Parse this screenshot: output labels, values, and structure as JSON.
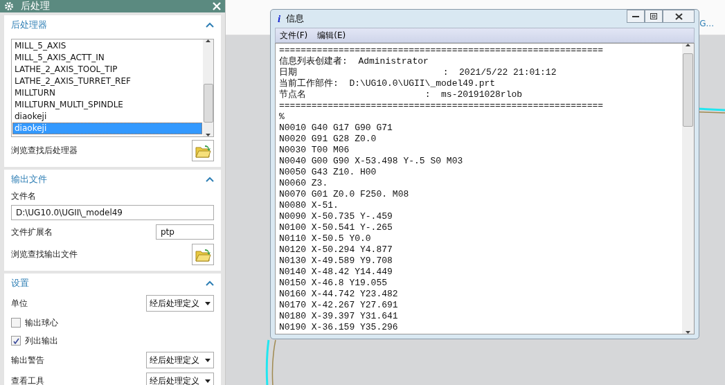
{
  "dialog": {
    "title": "后处理",
    "sections": [
      {
        "kind": "postprocessor",
        "title": "后处理器",
        "expanded": true,
        "list": [
          {
            "label": "MILL_5_AXIS",
            "selected": false
          },
          {
            "label": "MILL_5_AXIS_ACTT_IN",
            "selected": false
          },
          {
            "label": "LATHE_2_AXIS_TOOL_TIP",
            "selected": false
          },
          {
            "label": "LATHE_2_AXIS_TURRET_REF",
            "selected": false
          },
          {
            "label": "MILLTURN",
            "selected": false
          },
          {
            "label": "MILLTURN_MULTI_SPINDLE",
            "selected": false
          },
          {
            "label": "diaokeji",
            "selected": false
          },
          {
            "label": "diaokeji",
            "selected": true
          }
        ],
        "browse_label": "浏览查找后处理器"
      },
      {
        "kind": "output",
        "title": "输出文件",
        "expanded": true,
        "file_label": "文件名",
        "file_value": "D:\\UG10.0\\UGII\\_model49",
        "ext_label": "文件扩展名",
        "ext_value": "ptp",
        "browse_label": "浏览查找输出文件"
      },
      {
        "kind": "settings",
        "title": "设置",
        "expanded": true,
        "rows": [
          {
            "kind": "select",
            "label": "单位",
            "value": "经后处理定义"
          },
          {
            "kind": "checkbox",
            "label": "输出球心",
            "checked": false
          },
          {
            "kind": "checkbox",
            "label": "列出输出",
            "checked": true
          },
          {
            "kind": "select",
            "label": "输出警告",
            "value": "经后处理定义"
          },
          {
            "kind": "select",
            "label": "查看工具",
            "value": "经后处理定义"
          }
        ]
      }
    ]
  },
  "toolbar": {
    "group_label": "G..."
  },
  "info_window": {
    "icon_glyph": "i",
    "title": "信息",
    "menu": [
      "文件(F)",
      "编辑(E)"
    ],
    "lines": [
      "============================================================",
      "信息列表创建者:  Administrator",
      "日期                           :  2021/5/22 21:01:12",
      "当前工作部件:  D:\\UG10.0\\UGII\\_model49.prt",
      "节点名                      :  ms-20191028rlob",
      "============================================================",
      "%",
      "N0010 G40 G17 G90 G71",
      "N0020 G91 G28 Z0.0",
      "N0030 T00 M06",
      "N0040 G00 G90 X-53.498 Y-.5 S0 M03",
      "N0050 G43 Z10. H00",
      "N0060 Z3.",
      "N0070 G01 Z0.0 F250. M08",
      "N0080 X-51.",
      "N0090 X-50.735 Y-.459",
      "N0100 X-50.541 Y-.265",
      "N0110 X-50.5 Y0.0",
      "N0120 X-50.294 Y4.877",
      "N0130 X-49.589 Y9.708",
      "N0140 X-48.42 Y14.449",
      "N0150 X-46.8 Y19.055",
      "N0160 X-44.742 Y23.482",
      "N0170 X-42.267 Y27.691",
      "N0180 X-39.397 Y31.641",
      "N0190 X-36.159 Y35.296"
    ]
  }
}
